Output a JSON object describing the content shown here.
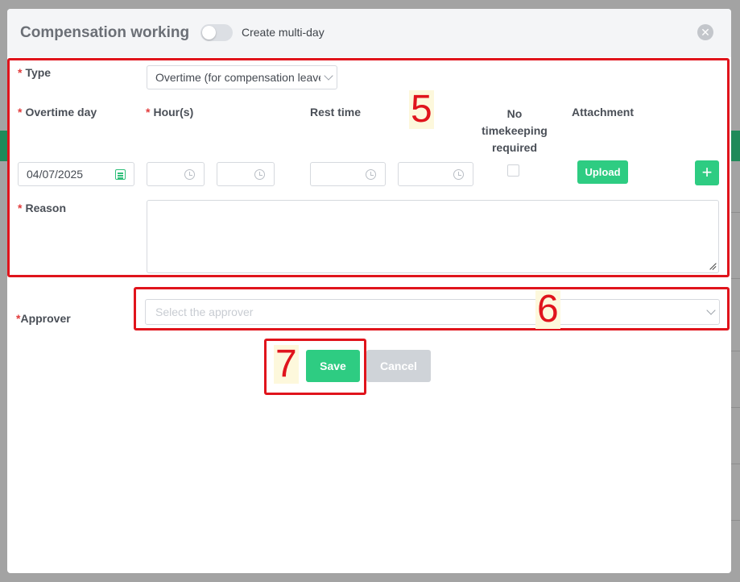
{
  "dialog": {
    "title": "Compensation working",
    "toggle_label": "Create multi-day",
    "toggle_on": false,
    "close_icon": "close-icon"
  },
  "form": {
    "required_mark": "*",
    "type_label": "Type",
    "type_value": "Overtime (for compensation leave)",
    "overtime_day_label": "Overtime day",
    "overtime_day_value": "04/07/2025",
    "hours_label": "Hour(s)",
    "rest_time_label": "Rest time",
    "no_timekeeping_label": "No timekeeping required",
    "no_timekeeping_checked": false,
    "attachment_label": "Attachment",
    "upload_label": "Upload",
    "add_label": "+",
    "reason_label": "Reason",
    "approver_label": "Approver",
    "approver_placeholder": "Select the approver"
  },
  "actions": {
    "save_label": "Save",
    "cancel_label": "Cancel"
  },
  "annotations": [
    {
      "label": "5"
    },
    {
      "label": "6"
    },
    {
      "label": "7"
    }
  ],
  "colors": {
    "primary": "#2ecc82",
    "annotation": "#e0141c",
    "required": "#e23b3b"
  }
}
